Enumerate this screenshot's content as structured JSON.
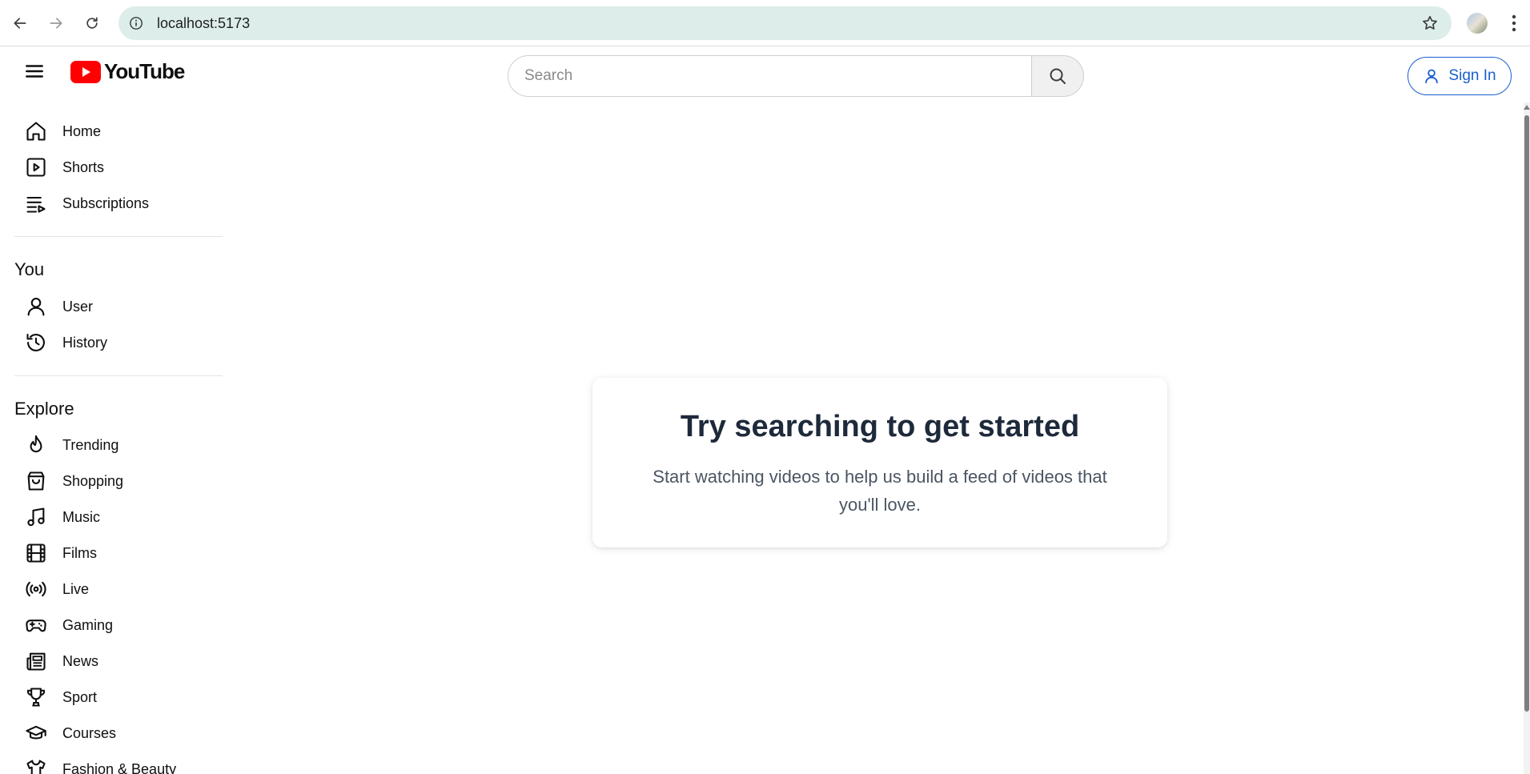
{
  "browser": {
    "url": "localhost:5173",
    "back_icon": "arrow-left-icon",
    "forward_icon": "arrow-right-icon",
    "reload_icon": "reload-icon"
  },
  "header": {
    "logo_text": "YouTube",
    "search_placeholder": "Search",
    "signin_label": "Sign In"
  },
  "sidebar": {
    "main": [
      {
        "label": "Home",
        "icon": "home-icon"
      },
      {
        "label": "Shorts",
        "icon": "shorts-icon"
      },
      {
        "label": "Subscriptions",
        "icon": "subscriptions-icon"
      }
    ],
    "you_heading": "You",
    "you": [
      {
        "label": "User",
        "icon": "user-icon"
      },
      {
        "label": "History",
        "icon": "history-icon"
      }
    ],
    "explore_heading": "Explore",
    "explore": [
      {
        "label": "Trending",
        "icon": "flame-icon"
      },
      {
        "label": "Shopping",
        "icon": "shopping-bag-icon"
      },
      {
        "label": "Music",
        "icon": "music-icon"
      },
      {
        "label": "Films",
        "icon": "film-icon"
      },
      {
        "label": "Live",
        "icon": "live-icon"
      },
      {
        "label": "Gaming",
        "icon": "gamepad-icon"
      },
      {
        "label": "News",
        "icon": "newspaper-icon"
      },
      {
        "label": "Sport",
        "icon": "trophy-icon"
      },
      {
        "label": "Courses",
        "icon": "graduation-cap-icon"
      },
      {
        "label": "Fashion & Beauty",
        "icon": "shirt-icon"
      }
    ]
  },
  "main": {
    "title": "Try searching to get started",
    "subtitle": "Start watching videos to help us build a feed of videos that you'll love."
  },
  "colors": {
    "brand_red": "#ff0000",
    "signin_blue": "#1a5fd0",
    "omnibox_bg": "#dcedea"
  }
}
